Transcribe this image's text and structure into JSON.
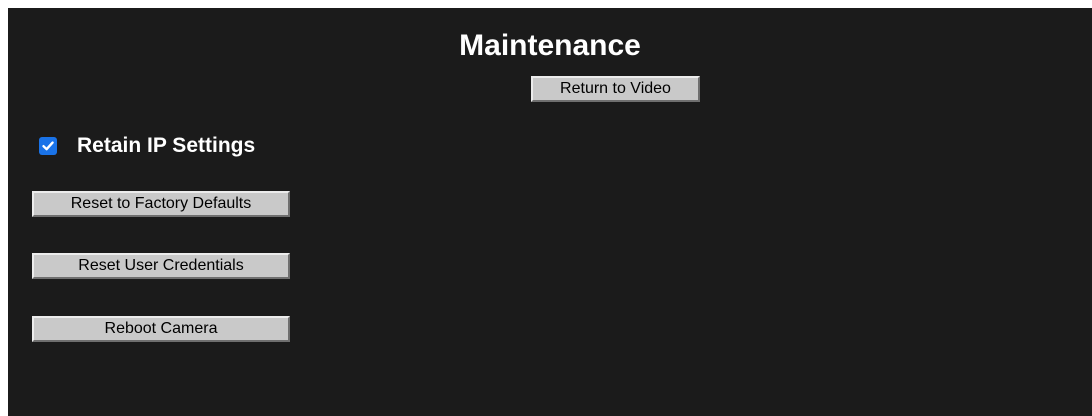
{
  "page": {
    "title": "Maintenance"
  },
  "nav": {
    "return_label": "Return to Video"
  },
  "settings": {
    "retain_ip_label": "Retain IP Settings",
    "retain_ip_checked": true
  },
  "actions": {
    "factory_reset_label": "Reset to Factory Defaults",
    "reset_credentials_label": "Reset User Credentials",
    "reboot_label": "Reboot Camera"
  },
  "icons": {
    "checkbox": "checkmark-icon"
  },
  "colors": {
    "background": "#1b1b1b",
    "button": "#c9c9c9",
    "checkbox_accent": "#1a73e8",
    "text": "#ffffff"
  }
}
